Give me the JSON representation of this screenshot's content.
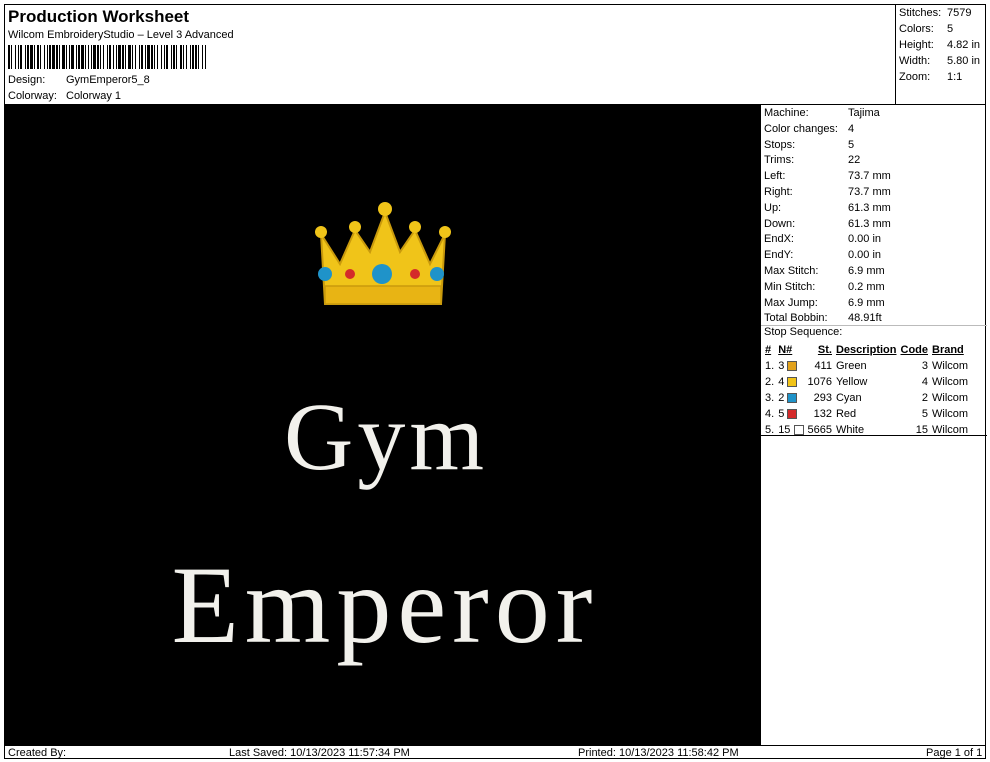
{
  "header": {
    "title": "Production Worksheet",
    "subtitle": "Wilcom EmbroideryStudio – Level 3 Advanced",
    "design_label": "Design:",
    "design_value": "GymEmperor5_8",
    "colorway_label": "Colorway:",
    "colorway_value": "Colorway 1"
  },
  "stats": [
    {
      "label": "Stitches:",
      "value": "7579"
    },
    {
      "label": "Colors:",
      "value": "5"
    },
    {
      "label": "Height:",
      "value": "4.82 in"
    },
    {
      "label": "Width:",
      "value": "5.80 in"
    },
    {
      "label": "Zoom:",
      "value": "1:1"
    }
  ],
  "specs": [
    {
      "label": "Machine:",
      "value": "Tajima"
    },
    {
      "label": "Color changes:",
      "value": "4"
    },
    {
      "label": "Stops:",
      "value": "5"
    },
    {
      "label": "Trims:",
      "value": "22"
    },
    {
      "label": "Left:",
      "value": "73.7 mm"
    },
    {
      "label": "Right:",
      "value": "73.7 mm"
    },
    {
      "label": "Up:",
      "value": "61.3 mm"
    },
    {
      "label": "Down:",
      "value": "61.3 mm"
    },
    {
      "label": "EndX:",
      "value": "0.00 in"
    },
    {
      "label": "EndY:",
      "value": "0.00 in"
    },
    {
      "label": "Max Stitch:",
      "value": "6.9 mm"
    },
    {
      "label": "Min Stitch:",
      "value": "0.2 mm"
    },
    {
      "label": "Max Jump:",
      "value": "6.9 mm"
    },
    {
      "label": "Total Bobbin:",
      "value": "48.91ft"
    }
  ],
  "stop_sequence": {
    "title": "Stop Sequence:",
    "headers": [
      "#",
      "N#",
      "St.",
      "Description",
      "Code",
      "Brand"
    ],
    "rows": [
      {
        "num": "1.",
        "n": "3",
        "color": "#e2a21c",
        "st": "411",
        "desc": "Green",
        "code": "3",
        "brand": "Wilcom"
      },
      {
        "num": "2.",
        "n": "4",
        "color": "#f2c418",
        "st": "1076",
        "desc": "Yellow",
        "code": "4",
        "brand": "Wilcom"
      },
      {
        "num": "3.",
        "n": "2",
        "color": "#1f93c9",
        "st": "293",
        "desc": "Cyan",
        "code": "2",
        "brand": "Wilcom"
      },
      {
        "num": "4.",
        "n": "5",
        "color": "#d42a2a",
        "st": "132",
        "desc": "Red",
        "code": "5",
        "brand": "Wilcom"
      },
      {
        "num": "5.",
        "n": "15",
        "color": "#ffffff",
        "st": "5665",
        "desc": "White",
        "code": "15",
        "brand": "Wilcom"
      }
    ]
  },
  "design": {
    "line1": "Gym",
    "line2": "Emperor",
    "background": "#000000",
    "thread_white": "#f2f1ec",
    "crown_gold": "#f0c419"
  },
  "footer": {
    "created": "Created By:",
    "saved": "Last Saved: 10/13/2023 11:57:34 PM",
    "printed": "Printed: 10/13/2023 11:58:42 PM",
    "page": "Page 1 of 1"
  }
}
